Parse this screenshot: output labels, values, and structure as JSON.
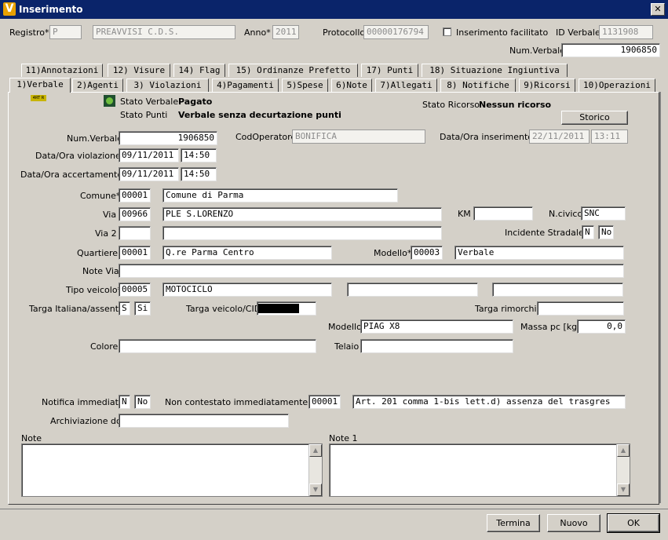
{
  "window": {
    "title": "Inserimento",
    "close_glyph": "✕",
    "logo_letter": "V"
  },
  "header": {
    "registro_label": "Registro*",
    "registro_value": "P",
    "registro_desc": "PREAVVISI C.D.S.",
    "anno_label": "Anno*",
    "anno_value": "2011",
    "protocollo_label": "Protocollo",
    "protocollo_value": "00000176794",
    "facilitato_label": "Inserimento facilitato",
    "idverbale_label": "ID Verbale",
    "idverbale_value": "1131908",
    "numverbale_label": "Num.Verbale",
    "numverbale_value": "1906850"
  },
  "tabs_row1": [
    "11)Annotazioni",
    "12) Visure",
    "14) Flag",
    "15) Ordinanze Prefetto",
    "17) Punti",
    "18) Situazione Ingiuntiva"
  ],
  "tabs_row2": [
    "1)Verbale",
    "2)Agenti",
    "3) Violazioni",
    "4)Pagamenti",
    "5)Spese",
    "6)Note",
    "7)Allegati",
    "8) Notifiche",
    "9)Ricorsi",
    "10)Operazioni"
  ],
  "badge": "4RT R",
  "status": {
    "stato_verbale_label": "Stato Verbale",
    "stato_verbale_value": "Pagato",
    "stato_punti_label": "Stato Punti",
    "stato_punti_value": "Verbale senza decurtazione punti",
    "stato_ricorso_label": "Stato Ricorso",
    "stato_ricorso_value": "Nessun ricorso",
    "storico_button": "Storico"
  },
  "form": {
    "numverbale_label": "Num.Verbale",
    "numverbale_value": "1906850",
    "codoperatore_label": "CodOperatore",
    "codoperatore_value": "BONIFICA",
    "datains_label": "Data/Ora inserimento*",
    "datains_date": "22/11/2011",
    "datains_time": "13:11",
    "dataviol_label": "Data/Ora violazione*",
    "dataviol_date": "09/11/2011",
    "dataviol_time": "14:50",
    "dataacc_label": "Data/Ora accertamento*",
    "dataacc_date": "09/11/2011",
    "dataacc_time": "14:50",
    "comune_label": "Comune*",
    "comune_code": "00001",
    "comune_name": "Comune di Parma",
    "via_label": "Via",
    "via_code": "00966",
    "via_name": "PLE S.LORENZO",
    "km_label": "KM",
    "km_value": "",
    "ncivico_label": "N.civico",
    "ncivico_value": "SNC",
    "via2_label": "Via 2",
    "via2_code": "",
    "via2_name": "",
    "incidente_label": "Incidente Stradale*",
    "incidente_code": "N",
    "incidente_value": "No",
    "quartiere_label": "Quartiere",
    "quartiere_code": "00001",
    "quartiere_name": "Q.re Parma Centro",
    "modello_label": "Modello*",
    "modello_code": "00003",
    "modello_name": "Verbale",
    "notevia_label": "Note Via",
    "notevia_value": "",
    "tipoveicolo_label": "Tipo veicolo*",
    "tipoveicolo_code": "00005",
    "tipoveicolo_name": "MOTOCICLO",
    "targaita_label": "Targa Italiana/assente",
    "targaita_code": "S",
    "targaita_value": "Si",
    "targaveicolo_label": "Targa veicolo/CID",
    "targarimorchio_label": "Targa rimorchio",
    "targarimorchio_value": "",
    "modelloveicolo_label": "Modello",
    "modelloveicolo_value": "PIAG X8",
    "massa_label": "Massa pc [kg]",
    "massa_value": "0,0",
    "colore_label": "Colore",
    "colore_value": "",
    "telaio_label": "Telaio",
    "telaio_value": "",
    "notifica_label": "Notifica immediata*",
    "notifica_code": "N",
    "notifica_value": "No",
    "noncont_label": "Non contestato immediatamente per:",
    "noncont_code": "00001",
    "noncont_desc": "Art. 201 comma 1-bis lett.d) assenza del trasgres",
    "archiviazione_label": "Archiviazione doc",
    "archiviazione_value": "",
    "note_label": "Note",
    "note1_label": "Note 1"
  },
  "footer": {
    "termina": "Termina",
    "nuovo": "Nuovo",
    "ok": "OK"
  }
}
